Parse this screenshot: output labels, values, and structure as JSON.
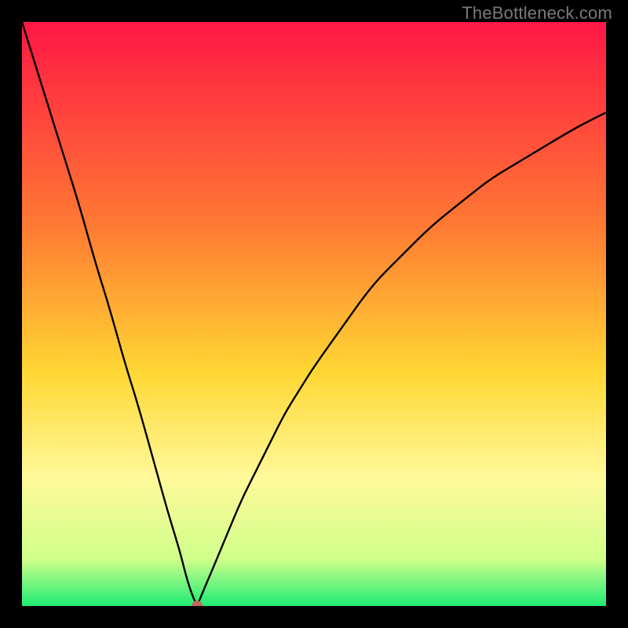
{
  "watermark": "TheBottleneck.com",
  "colors": {
    "page_bg": "#000000",
    "curve": "#000000",
    "dot": "#c06a5c",
    "gradient_stops": [
      {
        "offset": 0.0,
        "color": "#ff1744"
      },
      {
        "offset": 0.35,
        "color": "#ff7a33"
      },
      {
        "offset": 0.6,
        "color": "#ffd733"
      },
      {
        "offset": 0.78,
        "color": "#fff99a"
      },
      {
        "offset": 0.92,
        "color": "#d0ff8a"
      },
      {
        "offset": 1.0,
        "color": "#1eec74"
      }
    ]
  },
  "chart_data": {
    "type": "line",
    "title": "",
    "xlabel": "",
    "ylabel": "",
    "xlim": [
      0,
      100
    ],
    "ylim": [
      0,
      100
    ],
    "legend": false,
    "grid": false,
    "minimum": {
      "x": 30,
      "y": 0
    },
    "series": [
      {
        "name": "bottleneck-curve",
        "x": [
          0,
          2.5,
          5,
          7.5,
          10,
          12.5,
          15,
          17.5,
          20,
          22.5,
          25,
          27,
          28,
          29,
          30,
          31,
          32.5,
          35,
          37.5,
          40,
          42.5,
          45,
          47.5,
          50,
          55,
          60,
          65,
          70,
          75,
          80,
          85,
          90,
          95,
          100
        ],
        "values": [
          100,
          92,
          84,
          76,
          68,
          59,
          51,
          42,
          34,
          25,
          16,
          9.5,
          5.5,
          2.2,
          0,
          2.5,
          6,
          12,
          18,
          23,
          28,
          33,
          37,
          41,
          48,
          55,
          60,
          65,
          69,
          73,
          76,
          79,
          82,
          84.5
        ]
      }
    ],
    "marker": {
      "x": 30,
      "y": 0,
      "color": "#c06a5c"
    }
  }
}
